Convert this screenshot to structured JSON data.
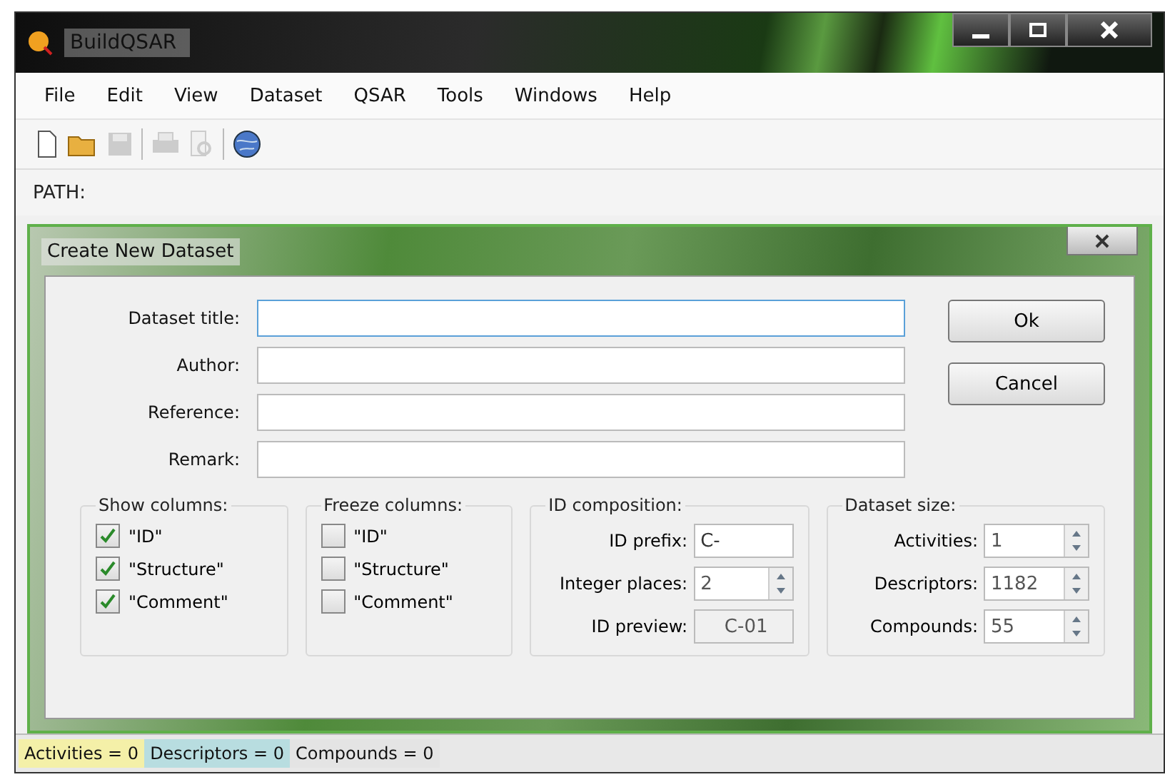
{
  "window": {
    "title": "BuildQSAR"
  },
  "menu": [
    "File",
    "Edit",
    "View",
    "Dataset",
    "QSAR",
    "Tools",
    "Windows",
    "Help"
  ],
  "toolbar": [
    {
      "kind": "new",
      "disabled": false
    },
    {
      "kind": "open",
      "disabled": false
    },
    {
      "kind": "save",
      "disabled": true
    },
    {
      "kind": "sep"
    },
    {
      "kind": "print",
      "disabled": true
    },
    {
      "kind": "preview",
      "disabled": true
    },
    {
      "kind": "sep"
    },
    {
      "kind": "globe",
      "disabled": false
    }
  ],
  "path_label": "PATH:",
  "dialog": {
    "title": "Create New Dataset",
    "fields": [
      {
        "label": "Dataset title:",
        "focused": true
      },
      {
        "label": "Author:",
        "focused": false
      },
      {
        "label": "Reference:",
        "focused": false
      },
      {
        "label": "Remark:",
        "focused": false
      }
    ],
    "buttons": [
      "Ok",
      "Cancel"
    ],
    "show_columns": {
      "title": "Show columns:",
      "items": [
        {
          "label": "\"ID\"",
          "checked": true
        },
        {
          "label": "\"Structure\"",
          "checked": true
        },
        {
          "label": "\"Comment\"",
          "checked": true
        }
      ]
    },
    "freeze_columns": {
      "title": "Freeze columns:",
      "items": [
        {
          "label": "\"ID\"",
          "checked": false
        },
        {
          "label": "\"Structure\"",
          "checked": false
        },
        {
          "label": "\"Comment\"",
          "checked": false
        }
      ]
    },
    "id_composition": {
      "title": "ID composition:",
      "rows": [
        {
          "label": "ID prefix:",
          "kind": "text",
          "value": "C-"
        },
        {
          "label": "Integer places:",
          "kind": "spinner",
          "value": "2"
        },
        {
          "label": "ID preview:",
          "kind": "readonly",
          "value": "C-01"
        }
      ]
    },
    "dataset_size": {
      "title": "Dataset size:",
      "rows": [
        {
          "label": "Activities:",
          "kind": "spinner",
          "value": "1"
        },
        {
          "label": "Descriptors:",
          "kind": "spinner",
          "value": "1182"
        },
        {
          "label": "Compounds:",
          "kind": "spinner",
          "value": "55"
        }
      ]
    }
  },
  "status_bar": [
    {
      "text": "Activities = 0",
      "color": "#f4f0a8"
    },
    {
      "text": "Descriptors = 0",
      "color": "#b8dde0"
    },
    {
      "text": "Compounds = 0",
      "color": "#e4e4e4"
    }
  ]
}
